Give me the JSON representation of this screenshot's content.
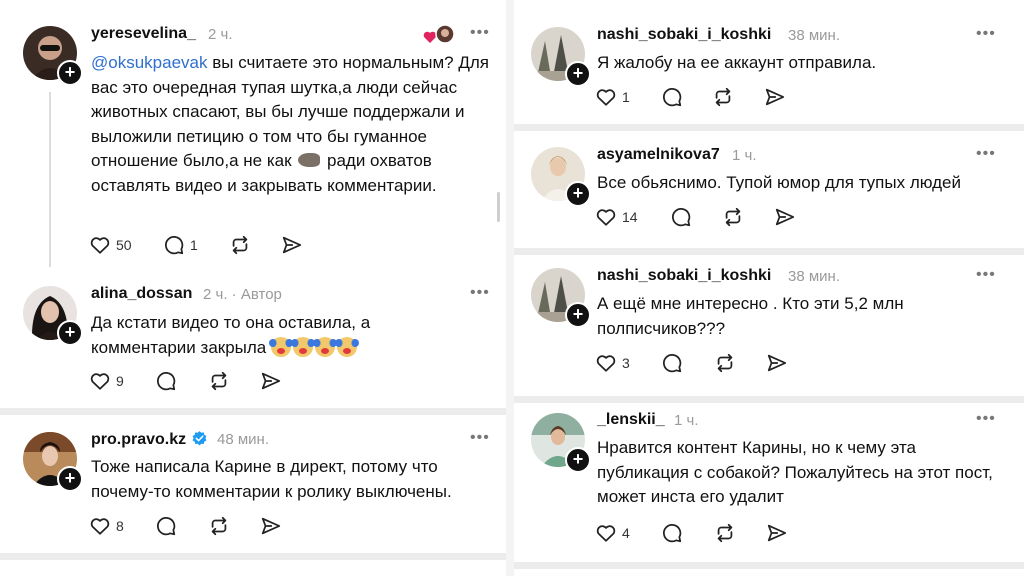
{
  "left": [
    {
      "username": "yeresevelina_",
      "time": "2 ч.",
      "mention": "@oksukpaevak",
      "text_after_mention": " вы считаете это нормальным? Для вас это очередная тупая шутка,а люди сейчас животных спасают, вы бы лучше поддержали и выложили петицию о том что бы гуманное отношение было,а не как ",
      "text_tail": " ради охватов оставлять видео и закрывать комментарии.",
      "likes": "50",
      "replies": "1"
    },
    {
      "username": "alina_dossan",
      "time": "2 ч.",
      "author_tag": "Автор",
      "text": "Да кстати видео то она оставила, а комментарии закрыла",
      "likes": "9"
    },
    {
      "username": "pro.pravo.kz",
      "time": "48 мин.",
      "text": "Тоже написала Карине в директ, потому что почему-то комментарии к ролику выключены.",
      "likes": "8"
    }
  ],
  "right": [
    {
      "username": "nashi_sobaki_i_koshki",
      "time": "38 мин.",
      "text": "Я жалобу на ее аккаунт отправила.",
      "likes": "1"
    },
    {
      "username": "asyamelnikova7",
      "time": "1 ч.",
      "text": "Все обьяснимо. Тупой юмор для тупых людей",
      "likes": "14"
    },
    {
      "username": "nashi_sobaki_i_koshki",
      "time": "38 мин.",
      "text": "А ещё мне интересно . Кто эти 5,2 млн полписчиков???",
      "likes": "3"
    },
    {
      "username": "_lenskii_",
      "time": "1 ч.",
      "text": "Нравится контент Карины, но к чему эта публикация с собакой? Пожалуйтесь на этот пост, может инста его удалит",
      "likes": "4"
    }
  ],
  "more_label": "•••",
  "plus_label": "+",
  "colors": {
    "mention": "#2f6fd0",
    "verified": "#1d9bf0",
    "heart": "#e0245e",
    "meta": "#9a9a9a"
  }
}
